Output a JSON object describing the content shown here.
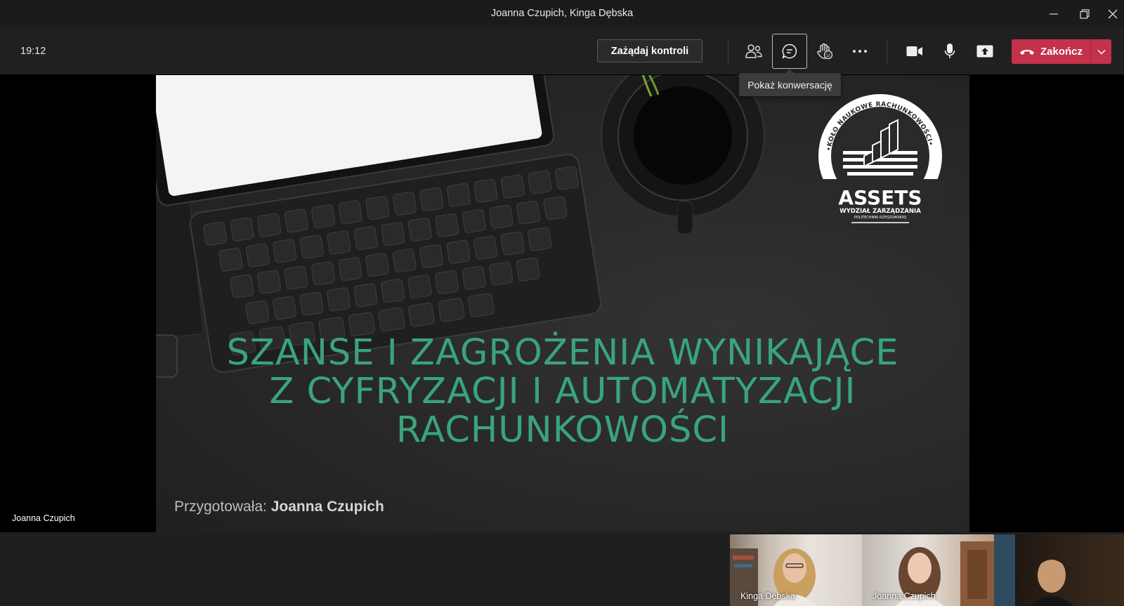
{
  "window": {
    "title": "Joanna Czupich, Kinga Dębska"
  },
  "toolbar": {
    "time": "19:12",
    "request_control_label": "Zażądaj kontroli",
    "end_label": "Zakończ",
    "tooltip": "Pokaż konwersację",
    "end_color": "#c4314b"
  },
  "icons": [
    "people-icon",
    "chat-icon",
    "raise-hand-icon",
    "more-options-icon",
    "camera-icon",
    "microphone-icon",
    "share-screen-icon",
    "hang-up-icon"
  ],
  "stage": {
    "presenter_name": "Joanna Czupich"
  },
  "slide": {
    "title_lines": [
      "SZANSE I ZAGROŻENIA WYNIKAJĄCE",
      "Z CYFRYZACJI I AUTOMATYZACJI",
      "RACHUNKOWOŚCI"
    ],
    "prepared_prefix": "Przygotowała:",
    "prepared_name": "Joanna Czupich",
    "title_color": "#3aa47c",
    "logo": {
      "ring_text": "•KOŁO NAUKOWE RACHUNKOWOŚCI•",
      "name": "ASSETS",
      "line1": "WYDZIAŁ ZARZĄDZANIA",
      "line2": "POLITECHNIKI RZESZOWSKIEJ"
    }
  },
  "participants": [
    {
      "name": "Kinga Dębska"
    },
    {
      "name": "Joanna Czupich"
    },
    {
      "name": ""
    }
  ]
}
